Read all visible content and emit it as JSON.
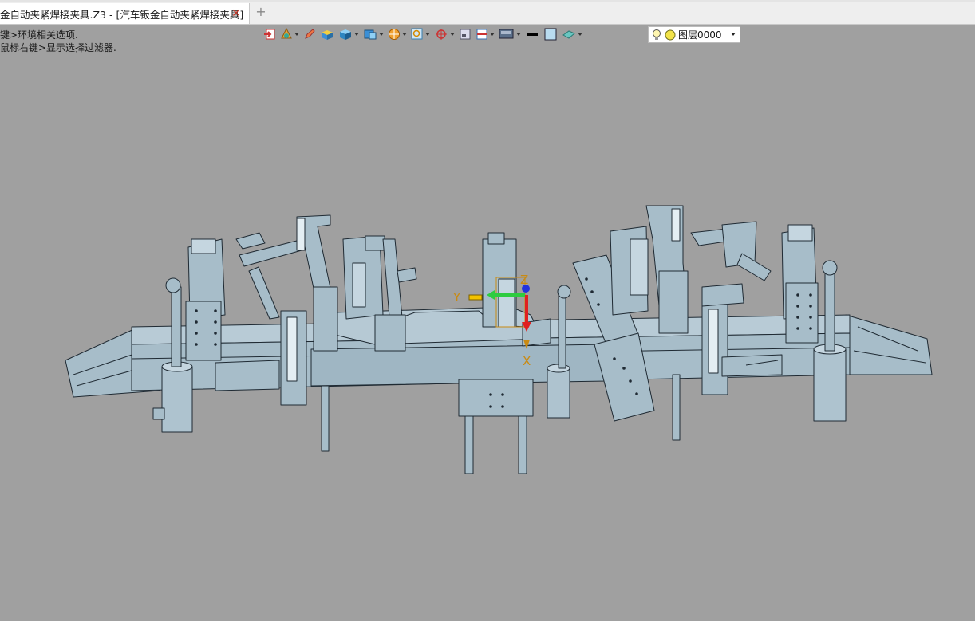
{
  "window": {
    "tab_title": "金自动夹紧焊接夹具.Z3 - [汽车钣金自动夹紧焊接夹具]",
    "close_glyph": "✕",
    "new_tab_glyph": "+"
  },
  "hints": {
    "line1": "键>环境相关选项.",
    "line2": "鼠标右键>显示选择过滤器."
  },
  "toolbar": {
    "layer_name": "图层0000",
    "icons": [
      "exit-icon",
      "shade-icon",
      "pencil-icon",
      "box-icon",
      "cube-icon",
      "view-cube-icon",
      "render-icon",
      "zoom-icon",
      "snap-icon",
      "frame-icon",
      "section-icon",
      "display-icon",
      "line-color-icon",
      "fill-color-icon",
      "material-icon",
      "bulb-icon",
      "layer-color-icon"
    ]
  },
  "triad": {
    "x_label": "X",
    "y_label": "Y",
    "z_label": "Z"
  },
  "colors": {
    "viewport_bg": "#a0a0a0",
    "model_fill": "#a7bdc9",
    "model_edge": "#1f2a33",
    "axis_x": "#e02020",
    "axis_y": "#2ecc40",
    "axis_z": "#2233dd"
  }
}
